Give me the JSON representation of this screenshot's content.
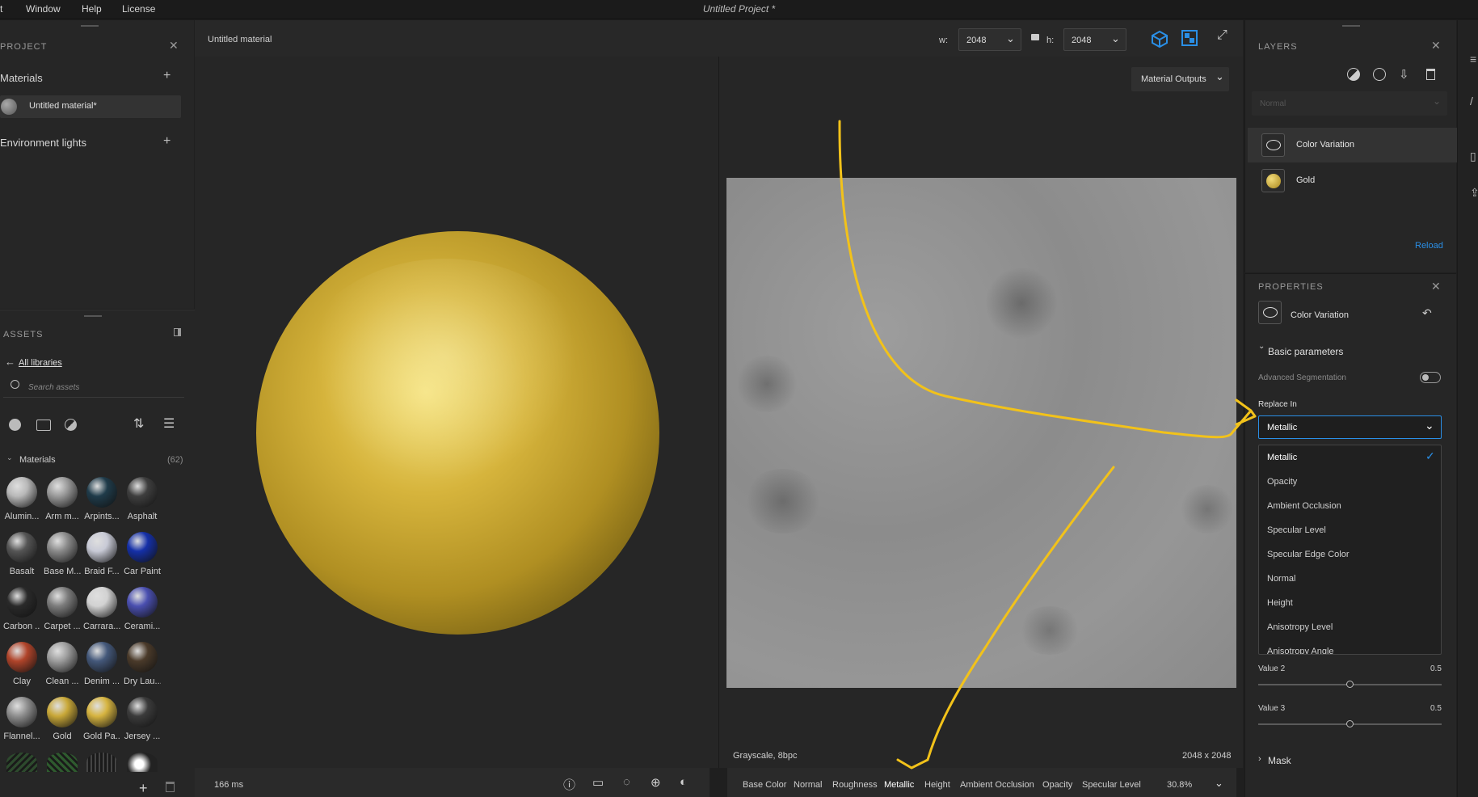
{
  "menu": {
    "items": [
      "t",
      "Window",
      "Help",
      "License"
    ],
    "app_title": "Untitled Project *"
  },
  "project_panel": {
    "title": "PROJECT",
    "materials_label": "Materials",
    "material_item": "Untitled material*",
    "env_lights_label": "Environment lights"
  },
  "assets_panel": {
    "title": "ASSETS",
    "back_label": "All libraries",
    "search_placeholder": "Search assets",
    "section_label": "Materials",
    "section_count": "(62)",
    "thumbs": [
      {
        "label": "Alumin...",
        "color": "#b9b9b9"
      },
      {
        "label": "Arm m...",
        "color": "#9a9a9a"
      },
      {
        "label": "Arpints...",
        "color": "#1f3b4a"
      },
      {
        "label": "Asphalt",
        "color": "#3e3e3e"
      },
      {
        "label": "Basalt",
        "color": "#555555"
      },
      {
        "label": "Base M...",
        "color": "#8a8a8a"
      },
      {
        "label": "Braid F...",
        "color": "#c8cad6"
      },
      {
        "label": "Car Paint",
        "color": "#1530a8"
      },
      {
        "label": "Carbon ...",
        "color": "#2a2a2a"
      },
      {
        "label": "Carpet ...",
        "color": "#7c7c7c"
      },
      {
        "label": "Carrara...",
        "color": "#d2d2d2"
      },
      {
        "label": "Cerami...",
        "color": "#4a4fb0"
      },
      {
        "label": "Clay",
        "color": "#b0442a"
      },
      {
        "label": "Clean ...",
        "color": "#9d9d9d"
      },
      {
        "label": "Denim ...",
        "color": "#44587a"
      },
      {
        "label": "Dry Lau...",
        "color": "#4a3a2a"
      },
      {
        "label": "Flannel...",
        "color": "#8f8f8f"
      },
      {
        "label": "Gold",
        "color": "#c9a838"
      },
      {
        "label": "Gold Pa...",
        "color": "#d6b440"
      },
      {
        "label": "Jersey ...",
        "color": "#3b3b3b"
      }
    ]
  },
  "viewport": {
    "tab_title": "Untitled material",
    "w_label": "w:",
    "w_value": "2048",
    "h_label": "h:",
    "h_value": "2048",
    "status_ms": "166 ms",
    "material_outputs": "Material Outputs",
    "texture_info": "Grayscale, 8bpc",
    "texture_size": "2048 x 2048",
    "channels": [
      "Base Color",
      "Normal",
      "Roughness",
      "Metallic",
      "Height",
      "Ambient Occlusion",
      "Opacity",
      "Specular Level"
    ],
    "zoom": "30.8%"
  },
  "layers_panel": {
    "title": "LAYERS",
    "blend_mode": "Normal",
    "layers": [
      "Color Variation",
      "Gold"
    ],
    "reload": "Reload"
  },
  "properties_panel": {
    "title": "PROPERTIES",
    "item_name": "Color Variation",
    "section_basic": "Basic parameters",
    "advanced_segmentation": "Advanced Segmentation",
    "replace_in_label": "Replace In",
    "replace_in_value": "Metallic",
    "options": [
      "Metallic",
      "Opacity",
      "Ambient Occlusion",
      "Specular Level",
      "Specular Edge Color",
      "Normal",
      "Height",
      "Anisotropy Level",
      "Anisotropy Angle"
    ],
    "value2_label": "Value 2",
    "value2": "0.5",
    "value3_label": "Value 3",
    "value3": "0.5",
    "mask_label": "Mask"
  },
  "colors": {
    "accent": "#2a8fe6",
    "annotation": "#f2c21a",
    "gold": "#c9a838"
  }
}
